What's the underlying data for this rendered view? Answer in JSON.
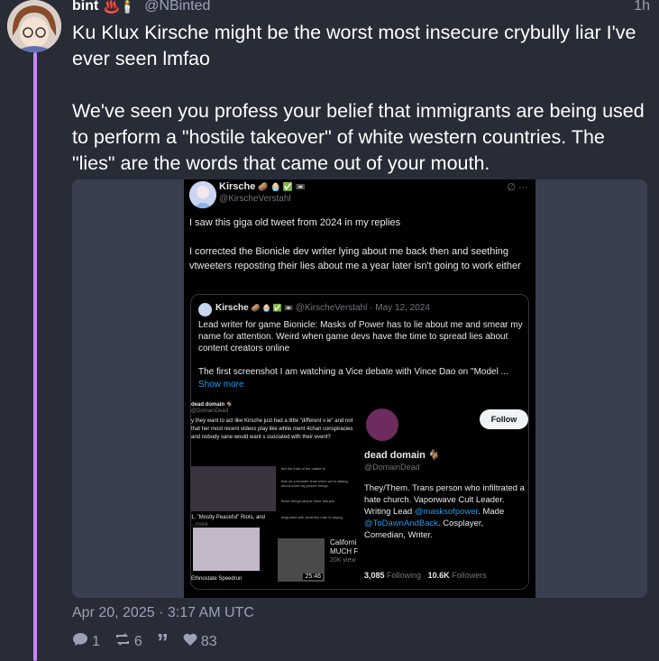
{
  "post": {
    "display_name": "bint",
    "name_emojis": "♨️🕯️",
    "handle": "@NBinted",
    "time": "1h",
    "text_line1": "Ku Klux Kirsche might be the worst most insecure crybully liar I've ever seen lmfao",
    "text_line2": "We've seen you profess your belief that immigrants are  being used to perform a \"hostile takeover\" of white western countries. The \"lies\" are the words that came out of your mouth.",
    "date": "Apr 20, 2025 · 3:17 AM UTC",
    "replies": "1",
    "boosts": "6",
    "quote_icon": "”",
    "likes": "83"
  },
  "screenshot": {
    "name": "Kirsche",
    "badges": "🥔 🧁 ✅ 📼",
    "handle": "@KirscheVerstahl",
    "more": "∅ ···",
    "text": "I saw this giga old tweet from 2024 in my replies\n\nI corrected the Bionicle dev writer lying about me back then and seething vtweeters reposting their lies about me a year later isn't going to work either",
    "quote": {
      "name": "Kirsche",
      "handle_date": "@KirscheVerstahl · May 12, 2024",
      "text": "Lead writer for game Bionicle: Masks of Power has to lie about me and smear my name for attention. Weird when game devs have the time to spread lies about content creators online\n\nThe first screenshot I am watching a Vice debate with Vince Dao on \"Model ...",
      "show_more": "Show more"
    },
    "collage": {
      "left_name": "dead domain 🐐",
      "left_handle": "@DomainDead",
      "left_text": "y they want to act like Kirsche just had a little \"different v ie\" and not that her most recent videos play like white ment 4chan conspiracies and nobody sane would want s ssociated with their event?",
      "video_caption": "1, \"Mostly Peaceful\" Riots, and",
      "more": "...more",
      "speedrun": "Ethnostate Speedrun",
      "timestamp": "25:46",
      "california": "Californi MUCH F",
      "views": "20K view",
      "follow": "Follow",
      "profile_name": "dead domain 🐐",
      "profile_handle": "@DomainDead",
      "bio1": "They/Them. Trans person who infiltrated a hate church. Vaporwave Cult Leader. Writing Lead ",
      "bio_link1": "@masksofpower",
      "bio2": ". Made ",
      "bio_link2": "@ToDawnAndBack",
      "bio3": ". Cosplayer, Comedian, Writer.",
      "following_count": "3,085",
      "following_label": "Following",
      "followers_count": "10.6K",
      "followers_label": "Followers"
    }
  }
}
